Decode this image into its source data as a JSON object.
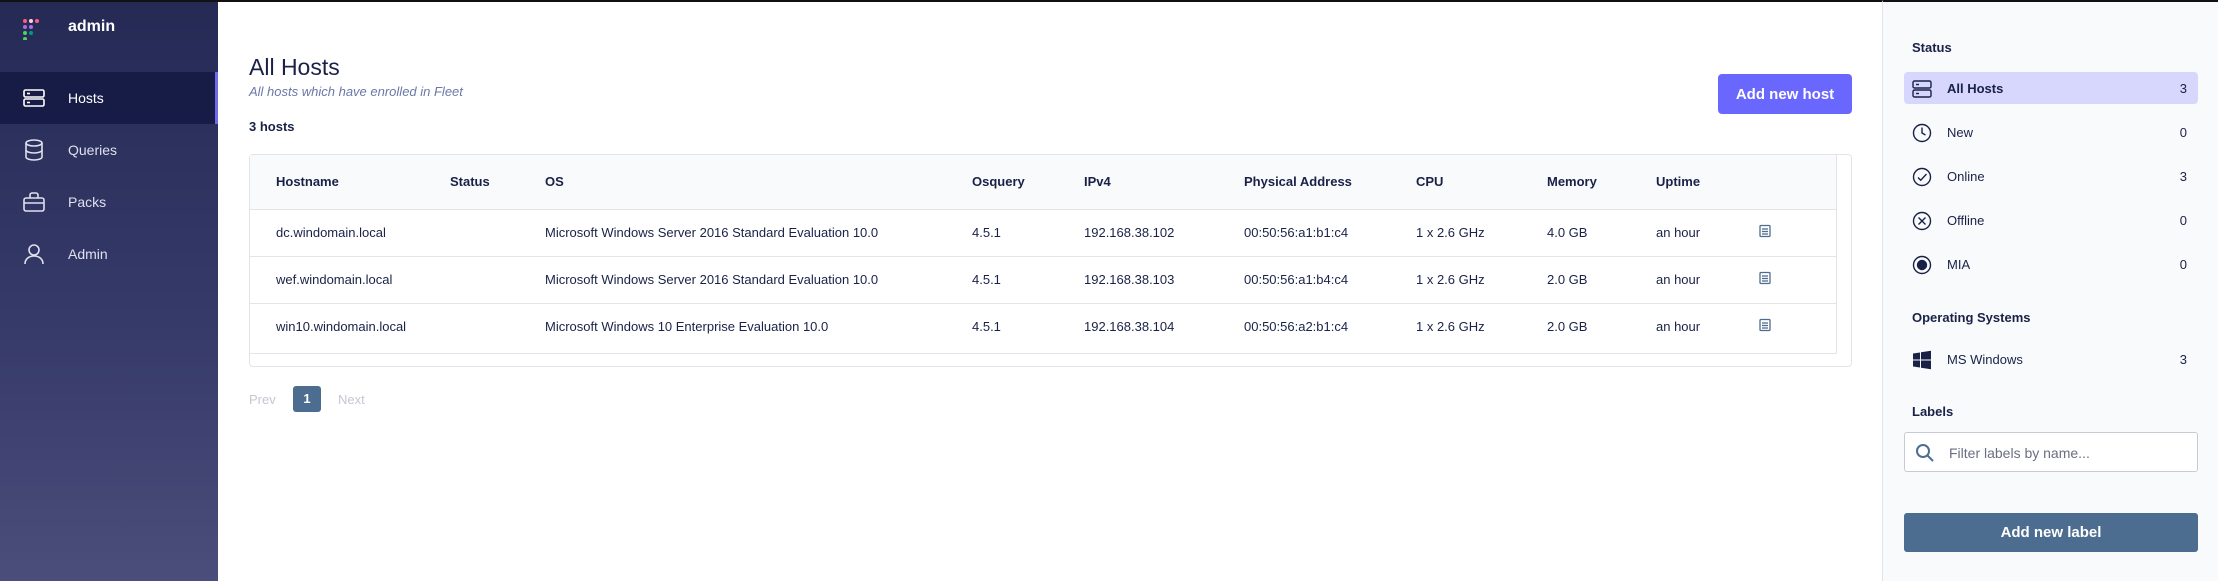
{
  "app": {
    "user": "admin"
  },
  "nav": [
    {
      "label": "Hosts",
      "icon": "hosts-icon",
      "active": true
    },
    {
      "label": "Queries",
      "icon": "queries-icon",
      "active": false
    },
    {
      "label": "Packs",
      "icon": "packs-icon",
      "active": false
    },
    {
      "label": "Admin",
      "icon": "admin-icon",
      "active": false
    }
  ],
  "main": {
    "title": "All Hosts",
    "subtitle": "All hosts which have enrolled in Fleet",
    "count": "3 hosts",
    "add_host_label": "Add new host"
  },
  "table": {
    "columns": [
      "Hostname",
      "Status",
      "OS",
      "Osquery",
      "IPv4",
      "Physical Address",
      "CPU",
      "Memory",
      "Uptime"
    ],
    "rows": [
      [
        "dc.windomain.local",
        "",
        "Microsoft Windows Server 2016 Standard Evaluation 10.0",
        "4.5.1",
        "192.168.38.102",
        "00:50:56:a1:b1:c4",
        "1 x 2.6 GHz",
        "4.0 GB",
        "an hour"
      ],
      [
        "wef.windomain.local",
        "",
        "Microsoft Windows Server 2016 Standard Evaluation 10.0",
        "4.5.1",
        "192.168.38.103",
        "00:50:56:a1:b4:c4",
        "1 x 2.6 GHz",
        "2.0 GB",
        "an hour"
      ],
      [
        "win10.windomain.local",
        "",
        "Microsoft Windows 10 Enterprise Evaluation 10.0",
        "4.5.1",
        "192.168.38.104",
        "00:50:56:a2:b1:c4",
        "1 x 2.6 GHz",
        "2.0 GB",
        "an hour"
      ]
    ]
  },
  "pagination": {
    "prev": "Prev",
    "page": "1",
    "next": "Next"
  },
  "panel": {
    "status_title": "Status",
    "status": [
      {
        "label": "All Hosts",
        "count": "3",
        "icon": "all-hosts-icon"
      },
      {
        "label": "New",
        "count": "0",
        "icon": "clock-icon"
      },
      {
        "label": "Online",
        "count": "3",
        "icon": "check-circle-icon"
      },
      {
        "label": "Offline",
        "count": "0",
        "icon": "x-circle-icon"
      },
      {
        "label": "MIA",
        "count": "0",
        "icon": "mia-icon"
      }
    ],
    "os_title": "Operating Systems",
    "os": [
      {
        "label": "MS Windows",
        "count": "3",
        "icon": "windows-icon"
      }
    ],
    "labels_title": "Labels",
    "filter_placeholder": "Filter labels by name...",
    "add_label": "Add new label"
  },
  "colors": {
    "accent": "#6a67fe",
    "sidebar": "#252a55",
    "button_secondary": "#4d6d90"
  }
}
